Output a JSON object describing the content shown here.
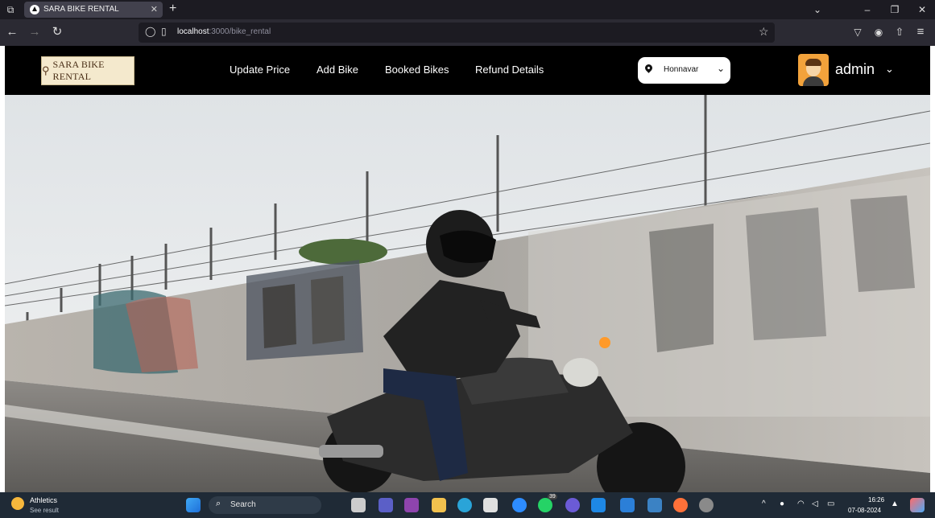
{
  "browser": {
    "tab_title": "SARA BIKE RENTAL",
    "url_host": "localhost",
    "url_path": ":3000/bike_rental"
  },
  "header": {
    "logo_text": "SARA BIKE RENTAL",
    "menu": [
      "Update Price",
      "Add Bike",
      "Booked Bikes",
      "Refund Details"
    ],
    "location": "Honnavar",
    "user": "admin"
  },
  "taskbar": {
    "weather_title": "Athletics",
    "weather_sub": "See result",
    "search": "Search",
    "badge_count": "39",
    "time": "16:26",
    "date": "07-08-2024"
  },
  "colors": {
    "header_bg": "#000000",
    "browser_bg": "#2b2a33",
    "taskbar_bg": "#1f2a36"
  }
}
